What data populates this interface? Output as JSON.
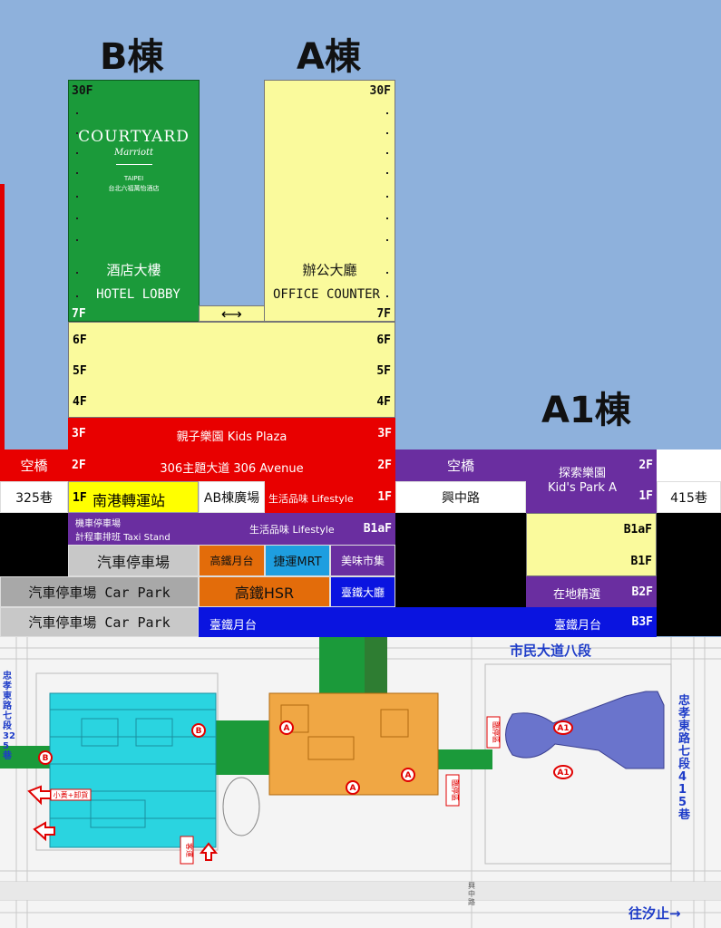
{
  "buildings": {
    "b": "B棟",
    "a": "A棟",
    "a1": "A1棟"
  },
  "tower_b": {
    "floor_top": "30F",
    "floor_bottom": "7F",
    "brand": "COURTYARD",
    "brand_sub": "Marriott",
    "city": "TAIPEI",
    "hotel_cn": "台北六福萬怡酒店",
    "lobby_cn": "酒店大樓",
    "lobby_en": "HOTEL LOBBY"
  },
  "tower_a": {
    "floor_top": "30F",
    "floor_bottom": "7F",
    "office_cn": "辦公大廳",
    "office_en": "OFFICE COUNTER"
  },
  "bridge_arrow": "⟷",
  "floors": {
    "f6": "6F",
    "f5": "5F",
    "f4": "4F",
    "f3": "3F",
    "f2": "2F",
    "f1": "1F",
    "b1af": "B1aF",
    "b1f": "B1F",
    "b2f": "B2F",
    "b3f": "B3F"
  },
  "row3f": {
    "text": "親子樂園 Kids Plaza"
  },
  "row2f": {
    "skybridge_left": "空橋",
    "text": "306主題大道 306 Avenue",
    "skybridge_right": "空橋",
    "explore": "探索樂園",
    "explore_en": "Kid's Park A"
  },
  "row1f": {
    "lane325": "325巷",
    "transit": "南港轉運站",
    "ab_plaza": "AB棟廣場",
    "lifestyle": "生活品味 Lifestyle",
    "xingzhong": "興中路",
    "lane415": "415巷"
  },
  "rowb1a": {
    "taxi1": "機車停車場",
    "taxi2": "計程車排班 Taxi Stand",
    "lifestyle": "生活品味 Lifestyle"
  },
  "rowb1": {
    "car": "汽車停車場",
    "hsr_platform": "高鐵月台",
    "mrt": "捷運MRT",
    "market": "美味市集"
  },
  "rowb2": {
    "car": "汽車停車場 Car Park",
    "hsr": "高鐵HSR",
    "tra_hall": "臺鐵大廳",
    "local": "在地精選"
  },
  "rowb3": {
    "car": "汽車停車場 Car Park",
    "tra_platform_left": "臺鐵月台",
    "tra_platform_right": "臺鐵月台"
  },
  "map": {
    "road_top": "市民大道八段",
    "road_left": "忠孝東路七段325巷",
    "road_right": "忠孝東路七段415巷",
    "to_xizhi": "往汐止→",
    "dropoff": "小黃+卸貨",
    "bus_stop": "臨停區",
    "bus_stop2": "臨停區",
    "xingzhong_label": "興中路",
    "marker_a": "A",
    "marker_b": "B",
    "marker_a1": "A1",
    "keyun": "客運"
  }
}
